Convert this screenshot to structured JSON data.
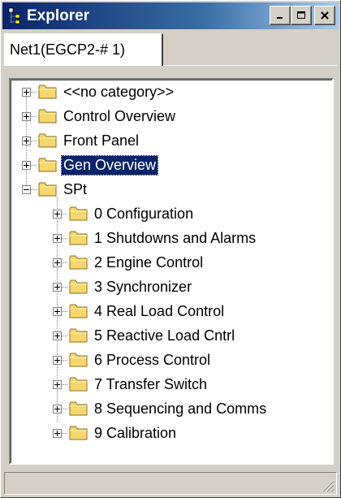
{
  "window": {
    "title": "Explorer",
    "icon": "explorer-tree-icon",
    "buttons": [
      "minimize-icon",
      "maximize-icon",
      "close-icon"
    ]
  },
  "tab": {
    "label": "Net1(EGCP2-# 1)"
  },
  "tree": {
    "root_items": [
      {
        "label": "<<no category>>",
        "expanded": false
      },
      {
        "label": "Control Overview",
        "expanded": false
      },
      {
        "label": "Front Panel",
        "expanded": false
      },
      {
        "label": "Gen Overview",
        "expanded": false,
        "selected": true
      },
      {
        "label": "SPt",
        "expanded": true
      }
    ],
    "spt_children": [
      {
        "label": "0 Configuration"
      },
      {
        "label": "1 Shutdowns and Alarms"
      },
      {
        "label": "2 Engine Control"
      },
      {
        "label": "3 Synchronizer"
      },
      {
        "label": "4 Real Load Control"
      },
      {
        "label": "5 Reactive Load Cntrl"
      },
      {
        "label": "6 Process Control"
      },
      {
        "label": "7 Transfer Switch"
      },
      {
        "label": "8 Sequencing and Comms"
      },
      {
        "label": "9 Calibration"
      }
    ]
  },
  "colors": {
    "titlebar_start": "#0a246a",
    "titlebar_end": "#a6caf0",
    "selection": "#0a246a",
    "folder_fill": "#f5d76e",
    "window_face": "#d4d0c8"
  }
}
